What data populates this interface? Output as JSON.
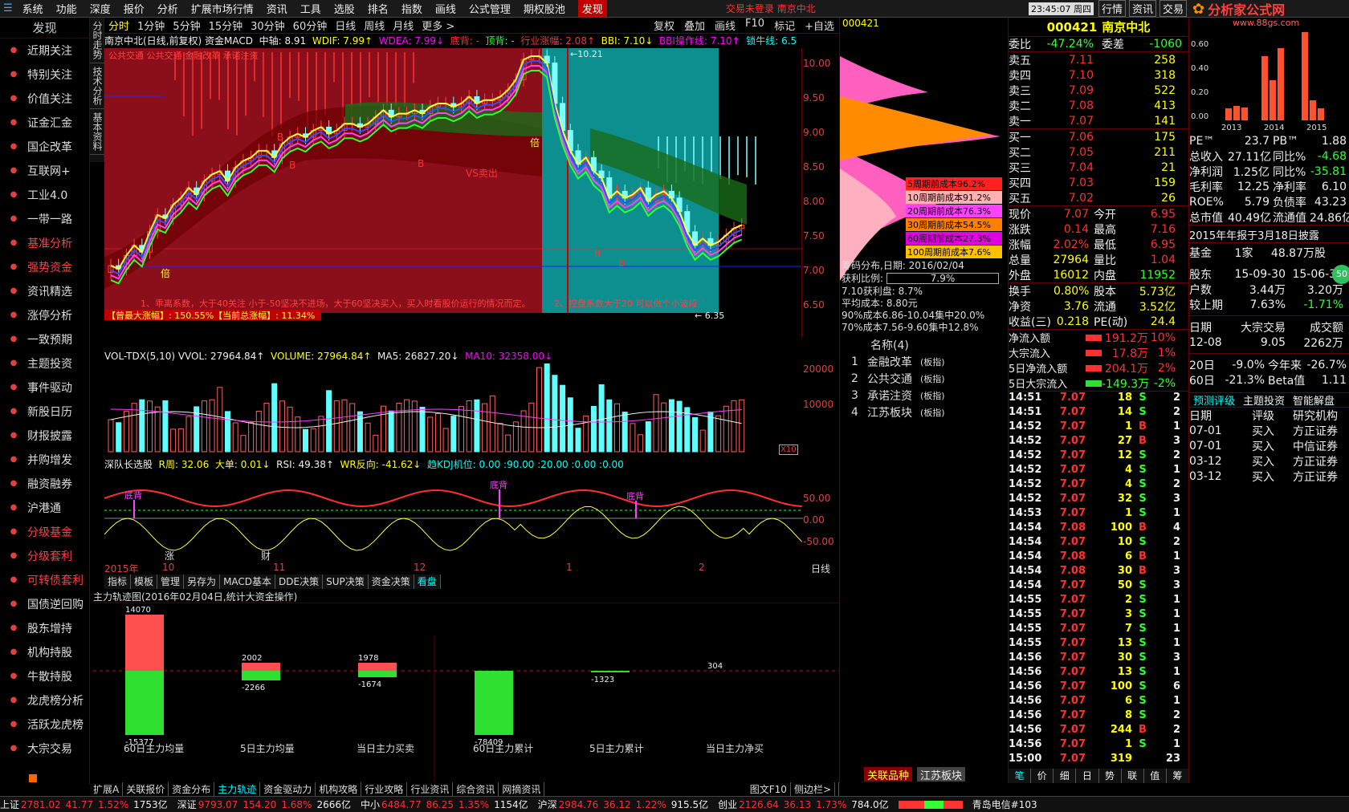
{
  "menu": [
    "系统",
    "功能",
    "深度",
    "报价",
    "分析",
    "扩展市场行情",
    "资讯",
    "工具",
    "选股",
    "排名",
    "指数",
    "画线",
    "公式管理",
    "期权股池",
    "发现"
  ],
  "menu_center": "交易未登录  南京中北",
  "menu_time": "23:45:07 周四",
  "menu_right": [
    "行情",
    "资讯",
    "交易"
  ],
  "logo": {
    "text": "分析家公式网",
    "url": "www.88gs.com"
  },
  "sidebar": {
    "head": "发现",
    "items": [
      "近期关注",
      "特别关注",
      "价值关注",
      "证金汇金",
      "国企改革",
      "互联网+",
      "工业4.0",
      "一带一路",
      "基准分析",
      "强势资金",
      "资讯精选",
      "涨停分析",
      "一致预期",
      "主题投资",
      "事件驱动",
      "新股日历",
      "财报披露",
      "并购增发",
      "融资融券",
      "沪港通",
      "分级基金",
      "分级套利",
      "可转债套利",
      "国债逆回购",
      "股东增持",
      "机构持股",
      "牛散持股",
      "龙虎榜分析",
      "活跃龙虎榜",
      "大宗交易"
    ]
  },
  "vtabs": [
    "分时走势",
    "技术分析",
    "基本资料"
  ],
  "periods": [
    "分时",
    "1分钟",
    "5分钟",
    "15分钟",
    "30分钟",
    "60分钟",
    "日线",
    "周线",
    "月线",
    "更多 >"
  ],
  "period_right": [
    "复权",
    "叠加",
    "画线",
    "F10",
    "标记",
    "+自选"
  ],
  "stock_code_top": "000421",
  "infobar": {
    "name": "南京中北(日线,前复权) 资金MACD",
    "zz": "中轴: 8.91",
    "wdif": "WDIF: 7.99↑",
    "wdea": "WDEA: 7.99↓",
    "db": "底背: -",
    "dg": "顶背: -",
    "hy": "行业涨幅: 2.08↑",
    "bbi": "BBI: 7.10↓",
    "bbic": "BBI操作线: 7.10↑",
    "ln": "锁牛线: 6.5"
  },
  "main_overlay": {
    "tags": "公共交通 公共交通 金融改革 承诺注资",
    "note1": "1、乖离系数，大于40关注 小于-50坚决不进场，大于60坚决买入，买入时看股价运行的情况而定。",
    "note2": "2、控盘系数大于20 可以做个小波段",
    "gain": "【曾最大涨幅】: 150.55%【当前总涨幅】: 11.34%",
    "high_label": "10.21",
    "low_label": "6.35",
    "marks": [
      "倍",
      "B",
      "B",
      "B",
      "倍",
      "B",
      "B",
      "VS卖出"
    ]
  },
  "y_main": [
    "10.00",
    "9.50",
    "9.00",
    "8.50",
    "8.00",
    "7.50",
    "7.00",
    "6.50"
  ],
  "volbar": {
    "a": "VOL-TDX(5,10)  VVOL: 27964.84↑",
    "b": "VOLUME: 27964.84↑",
    "c": "MA5: 26827.20↓",
    "d": "MA10: 32358.00↓"
  },
  "y_vol": [
    "20000",
    "10000"
  ],
  "vol_unit": "X10",
  "indbar": {
    "a": "深队长选股",
    "b": "R周: 32.06",
    "c": "大单: 0.01↓",
    "d": "RSI: 49.38↑",
    "e": "WR反向: -41.62↓",
    "f": "趋KDJ机位: 0.00 :90.00 :20.00 :0.00 :0.00"
  },
  "ind_marks": [
    "底背",
    "底背",
    "底背"
  ],
  "y_ind": [
    "50.00",
    "0.00",
    "-50.00"
  ],
  "dateaxis": [
    "2015年",
    "10",
    "11",
    "12",
    "1",
    "2"
  ],
  "date_right": "日线",
  "date_mid": [
    "涨",
    "财"
  ],
  "charttabs": [
    "指标",
    "模板",
    "管理",
    "另存为",
    "MACD基本",
    "DDE决策",
    "SUP决策",
    "资金决策",
    "看盘"
  ],
  "flow": {
    "title": "主力轨迹图(2016年02月04日,统计大资金操作)",
    "bars": [
      {
        "label": "60日主力均量",
        "top": "14070",
        "bot": "-15377"
      },
      {
        "label": "5日主力均量",
        "top": "2002",
        "bot": "-2266"
      },
      {
        "label": "当日主力买卖",
        "top": "1978",
        "bot": "-1674"
      },
      {
        "label": "60日主力累计",
        "top": "",
        "bot": "-78409"
      },
      {
        "label": "5日主力累计",
        "top": "",
        "bot": "-1323"
      },
      {
        "label": "当日主力净买",
        "top": "304",
        "bot": ""
      }
    ]
  },
  "bottomtabs": [
    "扩展A",
    "关联报价",
    "资金分布",
    "主力轨迹",
    "资金驱动力",
    "机构攻略",
    "行业攻略",
    "行业资讯",
    "综合资讯",
    "网摘资讯"
  ],
  "bottom_right": [
    "图文F10",
    "侧边栏>"
  ],
  "chip": {
    "lines": [
      {
        "t": "5周期前成本96.2%",
        "c": "#ff2020"
      },
      {
        "t": "10周期前成本91.2%",
        "c": "#ffb0b0"
      },
      {
        "t": "20周期前成本76.3%",
        "c": "#ff40ff"
      },
      {
        "t": "30周期前成本54.5%",
        "c": "#ff8000"
      },
      {
        "t": "60周期前成本27.3%",
        "c": "#e000e0"
      },
      {
        "t": "100周期前成本7.6%",
        "c": "#ffc000"
      }
    ],
    "date": "筹码分布,日期: 2016/02/04",
    "ratio_lbl": "获利比例:",
    "ratio": "7.9%",
    "info": [
      "7.10获利盘: 8.7%",
      "平均成本: 8.80元",
      "90%成本6.86-10.04集中20.0%",
      "70%成本7.56-9.60集中12.8%"
    ]
  },
  "related": {
    "title": "名称(4)",
    "items": [
      {
        "n": "金融改革",
        "t": "(板指)"
      },
      {
        "n": "公共交通",
        "t": "(板指)"
      },
      {
        "n": "承诺注资",
        "t": "(板指)"
      },
      {
        "n": "江苏板块",
        "t": "(板指)"
      }
    ],
    "tabs": [
      "关联品种",
      "江苏板块"
    ]
  },
  "quote": {
    "code": "000421",
    "name": "南京中北",
    "wb_label": "委比",
    "wb": "-47.24%",
    "wc_label": "委差",
    "wc": "-1060",
    "sells": [
      {
        "l": "卖五",
        "p": "7.11",
        "v": "258"
      },
      {
        "l": "卖四",
        "p": "7.10",
        "v": "318"
      },
      {
        "l": "卖三",
        "p": "7.09",
        "v": "522"
      },
      {
        "l": "卖二",
        "p": "7.08",
        "v": "413"
      },
      {
        "l": "卖一",
        "p": "7.07",
        "v": "141"
      }
    ],
    "buys": [
      {
        "l": "买一",
        "p": "7.06",
        "v": "175"
      },
      {
        "l": "买二",
        "p": "7.05",
        "v": "211"
      },
      {
        "l": "买三",
        "p": "7.04",
        "v": "21"
      },
      {
        "l": "买四",
        "p": "7.03",
        "v": "159"
      },
      {
        "l": "买五",
        "p": "7.02",
        "v": "26"
      }
    ],
    "stats": [
      [
        "现价",
        "7.07",
        "今开",
        "6.95"
      ],
      [
        "涨跌",
        "0.14",
        "最高",
        "7.16"
      ],
      [
        "涨幅",
        "2.02%",
        "最低",
        "6.95"
      ],
      [
        "总量",
        "27964",
        "量比",
        "1.04"
      ],
      [
        "外盘",
        "16012",
        "内盘",
        "11952"
      ]
    ],
    "stats2": [
      [
        "换手",
        "0.80%",
        "股本",
        "5.73亿"
      ],
      [
        "净资",
        "3.76",
        "流通",
        "3.52亿"
      ],
      [
        "收益(三)",
        "0.218",
        "PE(动)",
        "24.4"
      ]
    ],
    "flows": [
      {
        "l": "净流入额",
        "v": "191.2万",
        "p": "10%"
      },
      {
        "l": "大宗流入",
        "v": "17.8万",
        "p": "1%"
      },
      {
        "l": "5日净流入额",
        "v": "204.1万",
        "p": "2%"
      },
      {
        "l": "5日大宗流入",
        "v": "-149.3万",
        "p": "-2%"
      }
    ],
    "ticks": [
      [
        "14:51",
        "7.07",
        "18",
        "S",
        "2"
      ],
      [
        "14:51",
        "7.07",
        "14",
        "S",
        "2"
      ],
      [
        "14:52",
        "7.07",
        "1",
        "B",
        "1"
      ],
      [
        "14:52",
        "7.07",
        "27",
        "B",
        "3"
      ],
      [
        "14:52",
        "7.07",
        "12",
        "S",
        "2"
      ],
      [
        "14:52",
        "7.07",
        "4",
        "S",
        "1"
      ],
      [
        "14:52",
        "7.07",
        "4",
        "S",
        "2"
      ],
      [
        "14:52",
        "7.07",
        "32",
        "S",
        "3"
      ],
      [
        "14:53",
        "7.07",
        "1",
        "S",
        "1"
      ],
      [
        "14:54",
        "7.08",
        "100",
        "B",
        "4"
      ],
      [
        "14:54",
        "7.07",
        "10",
        "S",
        "2"
      ],
      [
        "14:54",
        "7.08",
        "6",
        "B",
        "1"
      ],
      [
        "14:54",
        "7.08",
        "30",
        "B",
        "3"
      ],
      [
        "14:54",
        "7.07",
        "50",
        "S",
        "3"
      ],
      [
        "14:55",
        "7.07",
        "2",
        "S",
        "1"
      ],
      [
        "14:55",
        "7.07",
        "3",
        "S",
        "1"
      ],
      [
        "14:55",
        "7.07",
        "7",
        "S",
        "1"
      ],
      [
        "14:55",
        "7.07",
        "13",
        "S",
        "1"
      ],
      [
        "14:56",
        "7.07",
        "30",
        "S",
        "3"
      ],
      [
        "14:56",
        "7.07",
        "13",
        "S",
        "1"
      ],
      [
        "14:56",
        "7.07",
        "100",
        "S",
        "6"
      ],
      [
        "14:56",
        "7.07",
        "6",
        "S",
        "1"
      ],
      [
        "14:56",
        "7.07",
        "8",
        "S",
        "2"
      ],
      [
        "14:56",
        "7.07",
        "244",
        "B",
        "2"
      ],
      [
        "14:56",
        "7.07",
        "1",
        "S",
        "1"
      ],
      [
        "15:00",
        "7.07",
        "319",
        "",
        "23"
      ]
    ],
    "tabs": [
      "笔",
      "价",
      "细",
      "日",
      "势",
      "联",
      "值",
      "筹"
    ]
  },
  "fin": {
    "years": [
      "2013",
      "2014",
      "2015"
    ],
    "ylabels": [
      "0.60",
      "0.40",
      "0.20",
      "0.00"
    ],
    "rows": [
      [
        "PE™",
        "23.7",
        "PB™",
        "1.88"
      ],
      [
        "总收入",
        "27.11亿",
        "同比%",
        "-4.68"
      ],
      [
        "净利润",
        "1.25亿",
        "同比%",
        "-35.81"
      ],
      [
        "毛利率",
        "12.25",
        "净利率",
        "6.10"
      ],
      [
        "ROE%",
        "5.79",
        "负债率",
        "43.23"
      ],
      [
        "总市值",
        "40.49亿",
        "流通值",
        "24.86亿"
      ]
    ],
    "note": "2015年年报于3月18日披露",
    "fund": [
      "基金",
      "1家",
      "48.87万股"
    ],
    "holders": [
      [
        "股东",
        "15-09-30",
        "15-06-30"
      ],
      [
        "户数",
        "3.44万",
        "3.20万"
      ],
      [
        "较上期",
        "7.63%",
        "-1.71%"
      ]
    ],
    "dz_head": [
      "日期",
      "大宗交易",
      "成交额"
    ],
    "dz_row": [
      "12-08",
      "9.05",
      "2262万"
    ],
    "perf": [
      [
        "20日",
        "-9.0%",
        "今年来",
        "-26.7%"
      ],
      [
        "60日",
        "-21.3%",
        "Beta值",
        "1.11"
      ]
    ],
    "tabs": [
      "预测评级",
      "主题投资",
      "智能解盘"
    ],
    "rating_head": [
      "日期",
      "评级",
      "研究机构"
    ],
    "ratings": [
      [
        "07-01",
        "买入",
        "方正证券"
      ],
      [
        "07-01",
        "买入",
        "中信证券"
      ],
      [
        "03-12",
        "买入",
        "方正证券"
      ],
      [
        "03-12",
        "买入",
        "方正证券"
      ]
    ],
    "badge": "50"
  },
  "status": [
    {
      "n": "上证",
      "v": "2781.02",
      "c": "41.77",
      "p": "1.52%",
      "a": "1753亿"
    },
    {
      "n": "深证",
      "v": "9793.07",
      "c": "154.20",
      "p": "1.68%",
      "a": "2666亿"
    },
    {
      "n": "中小",
      "v": "6484.77",
      "c": "86.25",
      "p": "1.35%",
      "a": "1154亿"
    },
    {
      "n": "沪深",
      "v": "2984.76",
      "c": "36.12",
      "p": "1.22%",
      "a": "915.5亿"
    },
    {
      "n": "创业",
      "v": "2126.64",
      "c": "36.13",
      "p": "1.73%",
      "a": "784.0亿"
    }
  ],
  "status_right": "青岛电信#103"
}
